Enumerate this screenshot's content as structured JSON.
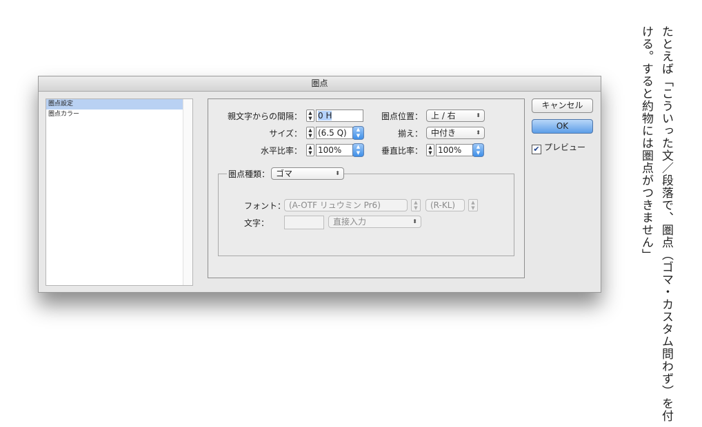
{
  "dialog": {
    "title": "圏点",
    "sidebar": [
      "圏点設定",
      "圏点カラー"
    ],
    "fields": {
      "spacing_label": "親文字からの間隔：",
      "spacing_value": "0 H",
      "size_label": "サイズ：",
      "size_value": "(6.5 Q)",
      "hratio_label": "水平比率：",
      "hratio_value": "100%",
      "position_label": "圏点位置：",
      "position_value": "上 / 右",
      "align_label": "揃え：",
      "align_value": "中付き",
      "vratio_label": "垂直比率：",
      "vratio_value": "100%"
    },
    "kind": {
      "label": "圏点種類：",
      "value": "ゴマ",
      "font_label": "フォント：",
      "font_value": "(A-OTF リュウミン Pr6)",
      "style_value": "(R-KL)",
      "char_label": "文字：",
      "char_value": "",
      "input_mode": "直接入力"
    },
    "buttons": {
      "cancel": "キャンセル",
      "ok": "OK",
      "preview": "プレビュー",
      "preview_checked": true
    }
  },
  "side_text": {
    "line1": "たとえば「こういった文／段落で、圏点（ゴマ・カスタム問わず）を付",
    "line2": "ける。すると約物には圏点がつきません」"
  }
}
